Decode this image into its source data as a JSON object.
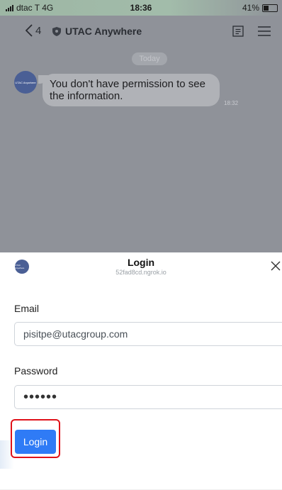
{
  "status_bar": {
    "carrier": "dtac T 4G",
    "time": "18:36",
    "battery": "41%"
  },
  "nav": {
    "back_count": "4",
    "title": "UTAC Anywhere"
  },
  "chat": {
    "date_divider": "Today",
    "avatar_text": "UTAC Anywhere",
    "message": "You don't have permission to see the information.",
    "message_time": "18:32"
  },
  "login_sheet": {
    "avatar_text": "UTAC Anywhere",
    "title": "Login",
    "subtitle": "52fad8cd.ngrok.io",
    "email_label": "Email",
    "email_value": "pisitpe@utacgroup.com",
    "password_label": "Password",
    "password_value": "••••••",
    "login_button": "Login"
  },
  "colors": {
    "accent": "#2f7bf6",
    "highlight": "#e0121a",
    "overlay": "#8f9299"
  }
}
